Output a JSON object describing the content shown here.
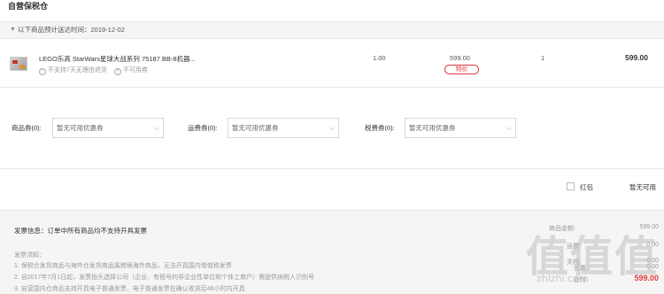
{
  "section": {
    "title": "自营保税仓"
  },
  "delivery": {
    "label": "以下商品预计送达时间：2019-12-02"
  },
  "product": {
    "name": "LEGO乐高 StarWars星球大战系列 75187 BB-8机器...",
    "services": [
      {
        "icon": "!",
        "text": "不支持7天无理由退货"
      },
      {
        "icon": "?",
        "text": "不可用券"
      }
    ],
    "qty_col_1": "1.00",
    "unit_price": "599.00",
    "tag": "特价",
    "qty_col_2": "1",
    "subtotal": "599.00"
  },
  "coupons": [
    {
      "label": "商品券(0):",
      "placeholder": "暂无可用优惠券"
    },
    {
      "label": "运费券(0):",
      "placeholder": "暂无可用优惠券"
    },
    {
      "label": "税费券(0):",
      "placeholder": "暂无可用优惠券"
    }
  ],
  "hongbao": {
    "label": "红包",
    "status": "暂无可用"
  },
  "footer": {
    "invoice": "发票信息：订单中所有商品均不支持开具发票",
    "notice_title": "发票须知：",
    "notices": [
      "1. 保税仓发货商品与海外仓发货商品属跨境海外商品，无法开具国内增值税发票",
      "2. 自2017年7月1日起，发票抬头选择公司（企业、有税号的非企业性单位和个体工商户）需提供纳税人识别号",
      "3. 自营国内仓商品支持开具电子普通发票，电子普通发票在确认收货后48小时内开具"
    ],
    "summary": [
      {
        "label": "商品金额:",
        "value": "599.00"
      },
      {
        "label": "运费:",
        "value": "0.00"
      },
      {
        "label": "关税:",
        "value": "0.00"
      },
      {
        "label": "优惠:",
        "value": "0.00"
      }
    ],
    "total_label": "应付:",
    "total": "599.00"
  },
  "watermark": {
    "glyphs": "值值值",
    "url": "zhizhi.com"
  }
}
